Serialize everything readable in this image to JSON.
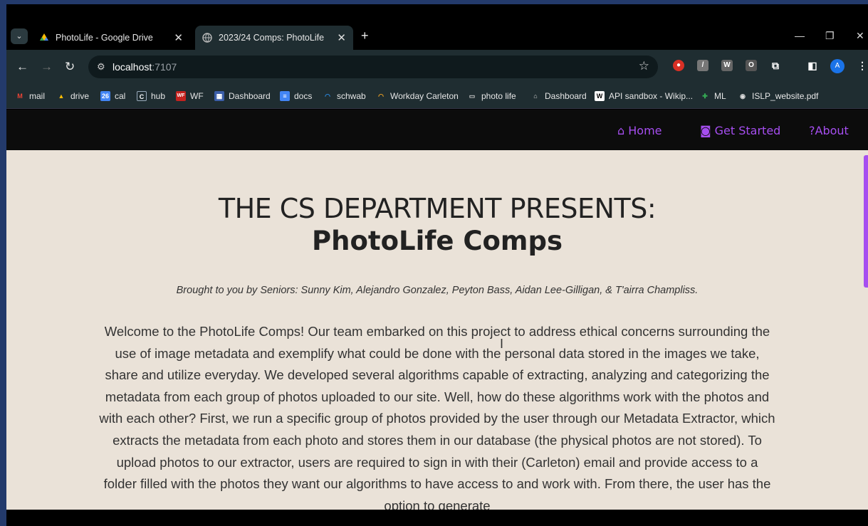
{
  "browser": {
    "tabs": [
      {
        "title": "PhotoLife - Google Drive",
        "icon": "google-drive-icon"
      },
      {
        "title": "2023/24 Comps: PhotoLife",
        "icon": "globe-icon",
        "active": true
      }
    ],
    "address": {
      "host": "localhost",
      "port": ":7107"
    },
    "bookmarks": [
      {
        "label": "mail",
        "icon": "gmail-icon"
      },
      {
        "label": "drive",
        "icon": "google-drive-icon"
      },
      {
        "label": "cal",
        "icon": "calendar-icon"
      },
      {
        "label": "hub",
        "icon": "c-icon"
      },
      {
        "label": "WF",
        "icon": "wf-icon"
      },
      {
        "label": "Dashboard",
        "icon": "dashboard-icon"
      },
      {
        "label": "docs",
        "icon": "docs-icon"
      },
      {
        "label": "schwab",
        "icon": "workday-icon"
      },
      {
        "label": "Workday Carleton",
        "icon": "workday-icon"
      },
      {
        "label": "photo life",
        "icon": "folder-icon"
      },
      {
        "label": "Dashboard",
        "icon": "home-icon"
      },
      {
        "label": "API sandbox - Wikip...",
        "icon": "wikipedia-icon"
      },
      {
        "label": "ML",
        "icon": "ml-icon"
      },
      {
        "label": "ISLP_website.pdf",
        "icon": "globe-icon"
      }
    ],
    "avatar_initial": "A"
  },
  "site": {
    "nav": {
      "home": "Home",
      "get_started": "Get Started",
      "about": "About"
    },
    "headline": "THE CS DEPARTMENT PRESENTS:",
    "subtitle": "PhotoLife Comps",
    "credits": "Brought to you by Seniors: Sunny Kim, Alejandro Gonzalez, Peyton Bass, Aidan Lee-Gilligan, & T'airra Champliss.",
    "body": "Welcome to the PhotoLife Comps! Our team embarked on this project to address ethical concerns surrounding the use of image metadata and exemplify what could be done with the personal data stored in the images we take, share and utilize everyday. We developed several algorithms capable of extracting, analyzing and categorizing the metadata from each group of photos uploaded to our site. Well, how do these algorithms work with the photos and with each other? First, we run a specific group of photos provided by the user through our Metadata Extractor, which extracts the metadata from each photo and stores them in our database (the physical photos are not stored). To upload photos to our extractor, users are required to sign in with their (Carleton) email and provide access to a folder filled with the photos they want our algorithms to have access to and work with. From there, the user has the option to generate",
    "accent_color": "#a64ef0"
  }
}
